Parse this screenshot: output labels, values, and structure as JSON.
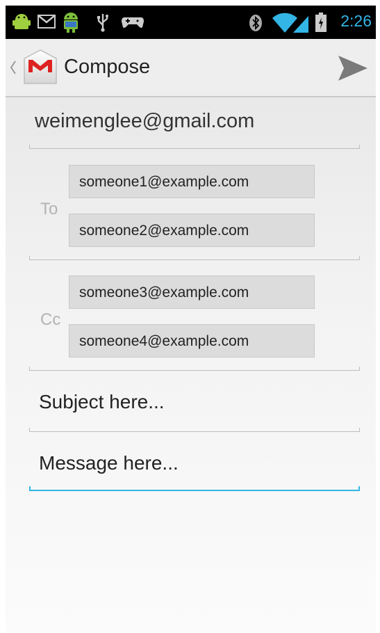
{
  "status_bar": {
    "time": "2:26",
    "icons": [
      "android-icon",
      "gmail-notification-icon",
      "android-robot-icon",
      "usb-icon",
      "game-controller-icon",
      "bluetooth-icon",
      "wifi-icon",
      "signal-icon",
      "battery-charging-icon"
    ],
    "accent": "#33b5e5"
  },
  "action_bar": {
    "title": "Compose",
    "icons": [
      "up-caret-icon",
      "gmail-icon",
      "send-icon"
    ]
  },
  "compose": {
    "from": "weimenglee@gmail.com",
    "to_label": "To",
    "to_recipients": [
      "someone1@example.com",
      "someone2@example.com"
    ],
    "cc_label": "Cc",
    "cc_recipients": [
      "someone3@example.com",
      "someone4@example.com"
    ],
    "subject_placeholder": "Subject here...",
    "message_placeholder": "Message here..."
  }
}
